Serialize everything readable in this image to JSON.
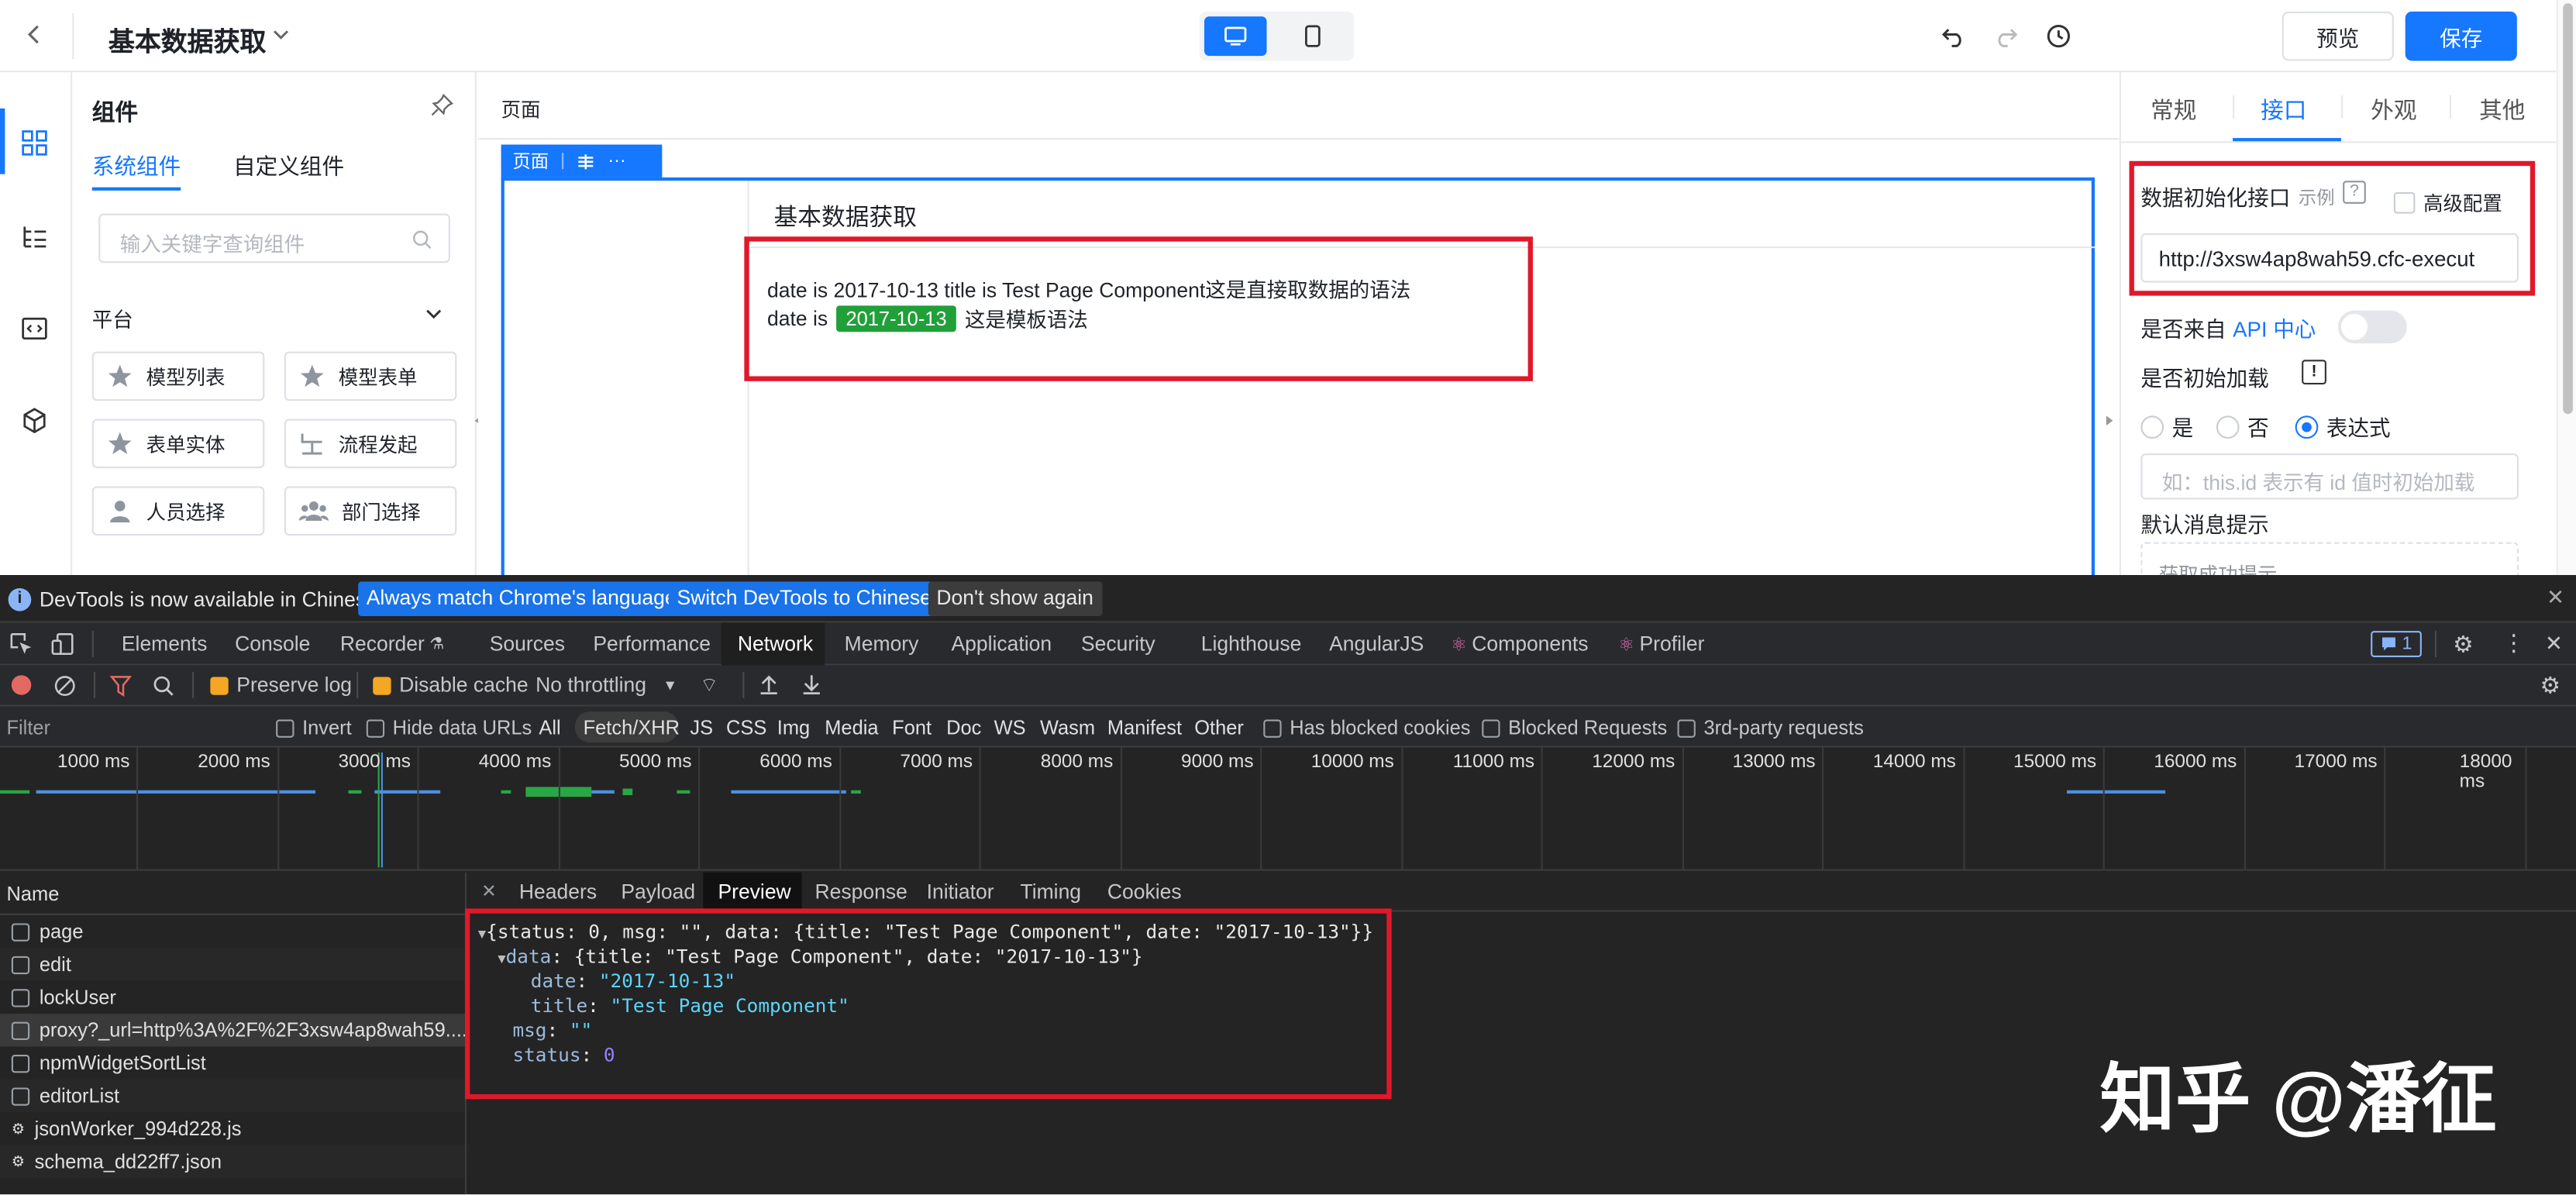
{
  "topbar": {
    "title": "基本数据获取",
    "preview_label": "预览",
    "save_label": "保存"
  },
  "components_panel": {
    "title": "组件",
    "tabs": [
      "系统组件",
      "自定义组件"
    ],
    "search_placeholder": "输入关键字查询组件",
    "section_title": "平台",
    "items": [
      "模型列表",
      "模型表单",
      "表单实体",
      "流程发起",
      "人员选择",
      "部门选择"
    ]
  },
  "canvas": {
    "header": "页面",
    "chip_label": "页面",
    "chip_more": "···",
    "page_title": "基本数据获取",
    "line1": "date is 2017-10-13 title is Test Page Component这是直接取数据的语法",
    "line2_prefix": "date is",
    "line2_tag": "2017-10-13",
    "line2_suffix": "这是模板语法"
  },
  "right_panel": {
    "tabs": [
      "常规",
      "接口",
      "外观",
      "其他"
    ],
    "active_tab": "接口",
    "init_api_label": "数据初始化接口",
    "example_label": "示例",
    "advanced_label": "高级配置",
    "init_api_value": "http://3xsw4ap8wah59.cfc-execut",
    "from_api_label_prefix": "是否来自",
    "from_api_label_link": "API 中心",
    "init_load_label": "是否初始加载",
    "radio_options": [
      "是",
      "否",
      "表达式"
    ],
    "radio_selected": "表达式",
    "expr_placeholder": "如：this.id 表示有 id 值时初始加载",
    "default_msg_label": "默认消息提示",
    "default_msg_value": "获取成功提示"
  },
  "devtools": {
    "notice": "DevTools is now available in Chinese!",
    "notice_btn1": "Always match Chrome's language",
    "notice_btn2": "Switch DevTools to Chinese",
    "notice_btn3": "Don't show again",
    "tabs": [
      "Elements",
      "Console",
      "Recorder",
      "Sources",
      "Performance",
      "Network",
      "Memory",
      "Application",
      "Security",
      "Lighthouse",
      "AngularJS",
      "Components",
      "Profiler"
    ],
    "active_tab": "Network",
    "issues_count": "1",
    "toolbar": {
      "preserve_log": "Preserve log",
      "disable_cache": "Disable cache",
      "throttling": "No throttling"
    },
    "filter_placeholder": "Filter",
    "filter_invert": "Invert",
    "filter_hide_data": "Hide data URLs",
    "filter_types": [
      "All",
      "Fetch/XHR",
      "JS",
      "CSS",
      "Img",
      "Media",
      "Font",
      "Doc",
      "WS",
      "Wasm",
      "Manifest",
      "Other"
    ],
    "filter_type_active": "Fetch/XHR",
    "filter_blocked_cookies": "Has blocked cookies",
    "filter_blocked_requests": "Blocked Requests",
    "filter_third_party": "3rd-party requests",
    "timeline_ticks": [
      "1000 ms",
      "2000 ms",
      "3000 ms",
      "4000 ms",
      "5000 ms",
      "6000 ms",
      "7000 ms",
      "8000 ms",
      "9000 ms",
      "10000 ms",
      "11000 ms",
      "12000 ms",
      "13000 ms",
      "14000 ms",
      "15000 ms",
      "16000 ms",
      "17000 ms",
      "18000 ms"
    ],
    "name_header": "Name",
    "requests": [
      "page",
      "edit",
      "lockUser",
      "proxy?_url=http%3A%2F%2F3xsw4ap8wah59....",
      "npmWidgetSortList",
      "editorList",
      "jsonWorker_994d228.js",
      "schema_dd22ff7.json"
    ],
    "selected_request": "proxy?_url=http%3A%2F%2F3xsw4ap8wah59....",
    "detail_tabs": [
      "Headers",
      "Payload",
      "Preview",
      "Response",
      "Initiator",
      "Timing",
      "Cookies"
    ],
    "detail_active": "Preview",
    "preview": {
      "line1": "{status: 0, msg: \"\", data: {title: \"Test Page Component\", date: \"2017-10-13\"}}",
      "line2_key": "data",
      "line2_val": "{title: \"Test Page Component\", date: \"2017-10-13\"}",
      "date_key": "date",
      "date_val": "\"2017-10-13\"",
      "title_key": "title",
      "title_val": "\"Test Page Component\"",
      "msg_key": "msg",
      "msg_val": "\"\"",
      "status_key": "status",
      "status_val": "0"
    }
  },
  "watermark": "知乎 @潘征",
  "colors": {
    "primary": "#1677ff",
    "highlight_red": "#e0182a",
    "tag_green": "#21a03a",
    "devtools_bg": "#242424",
    "notice_btn": "#1a73e8"
  }
}
